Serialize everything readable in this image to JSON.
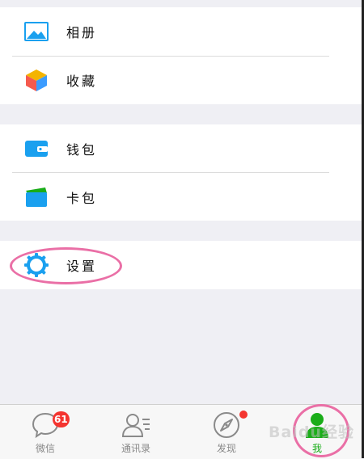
{
  "menu": {
    "groups": [
      {
        "items": [
          {
            "label": "相册",
            "icon": "photo-album-icon"
          },
          {
            "label": "收藏",
            "icon": "favorites-cube-icon"
          }
        ]
      },
      {
        "items": [
          {
            "label": "钱包",
            "icon": "wallet-icon"
          },
          {
            "label": "卡包",
            "icon": "card-pack-icon"
          }
        ]
      },
      {
        "items": [
          {
            "label": "设置",
            "icon": "settings-gear-icon"
          }
        ]
      }
    ]
  },
  "tabbar": {
    "tabs": [
      {
        "label": "微信",
        "icon": "chat-bubble-icon",
        "badge": "61"
      },
      {
        "label": "通讯录",
        "icon": "contacts-icon"
      },
      {
        "label": "发现",
        "icon": "compass-icon",
        "dot": true
      },
      {
        "label": "我",
        "icon": "me-person-icon",
        "active": true
      }
    ]
  },
  "watermark": "Baidu经验",
  "colors": {
    "background": "#efeff4",
    "accent_green": "#1aad19",
    "badge_red": "#f43530",
    "icon_blue": "#1aa0ef",
    "annotation_pink": "#ea6fa6"
  }
}
